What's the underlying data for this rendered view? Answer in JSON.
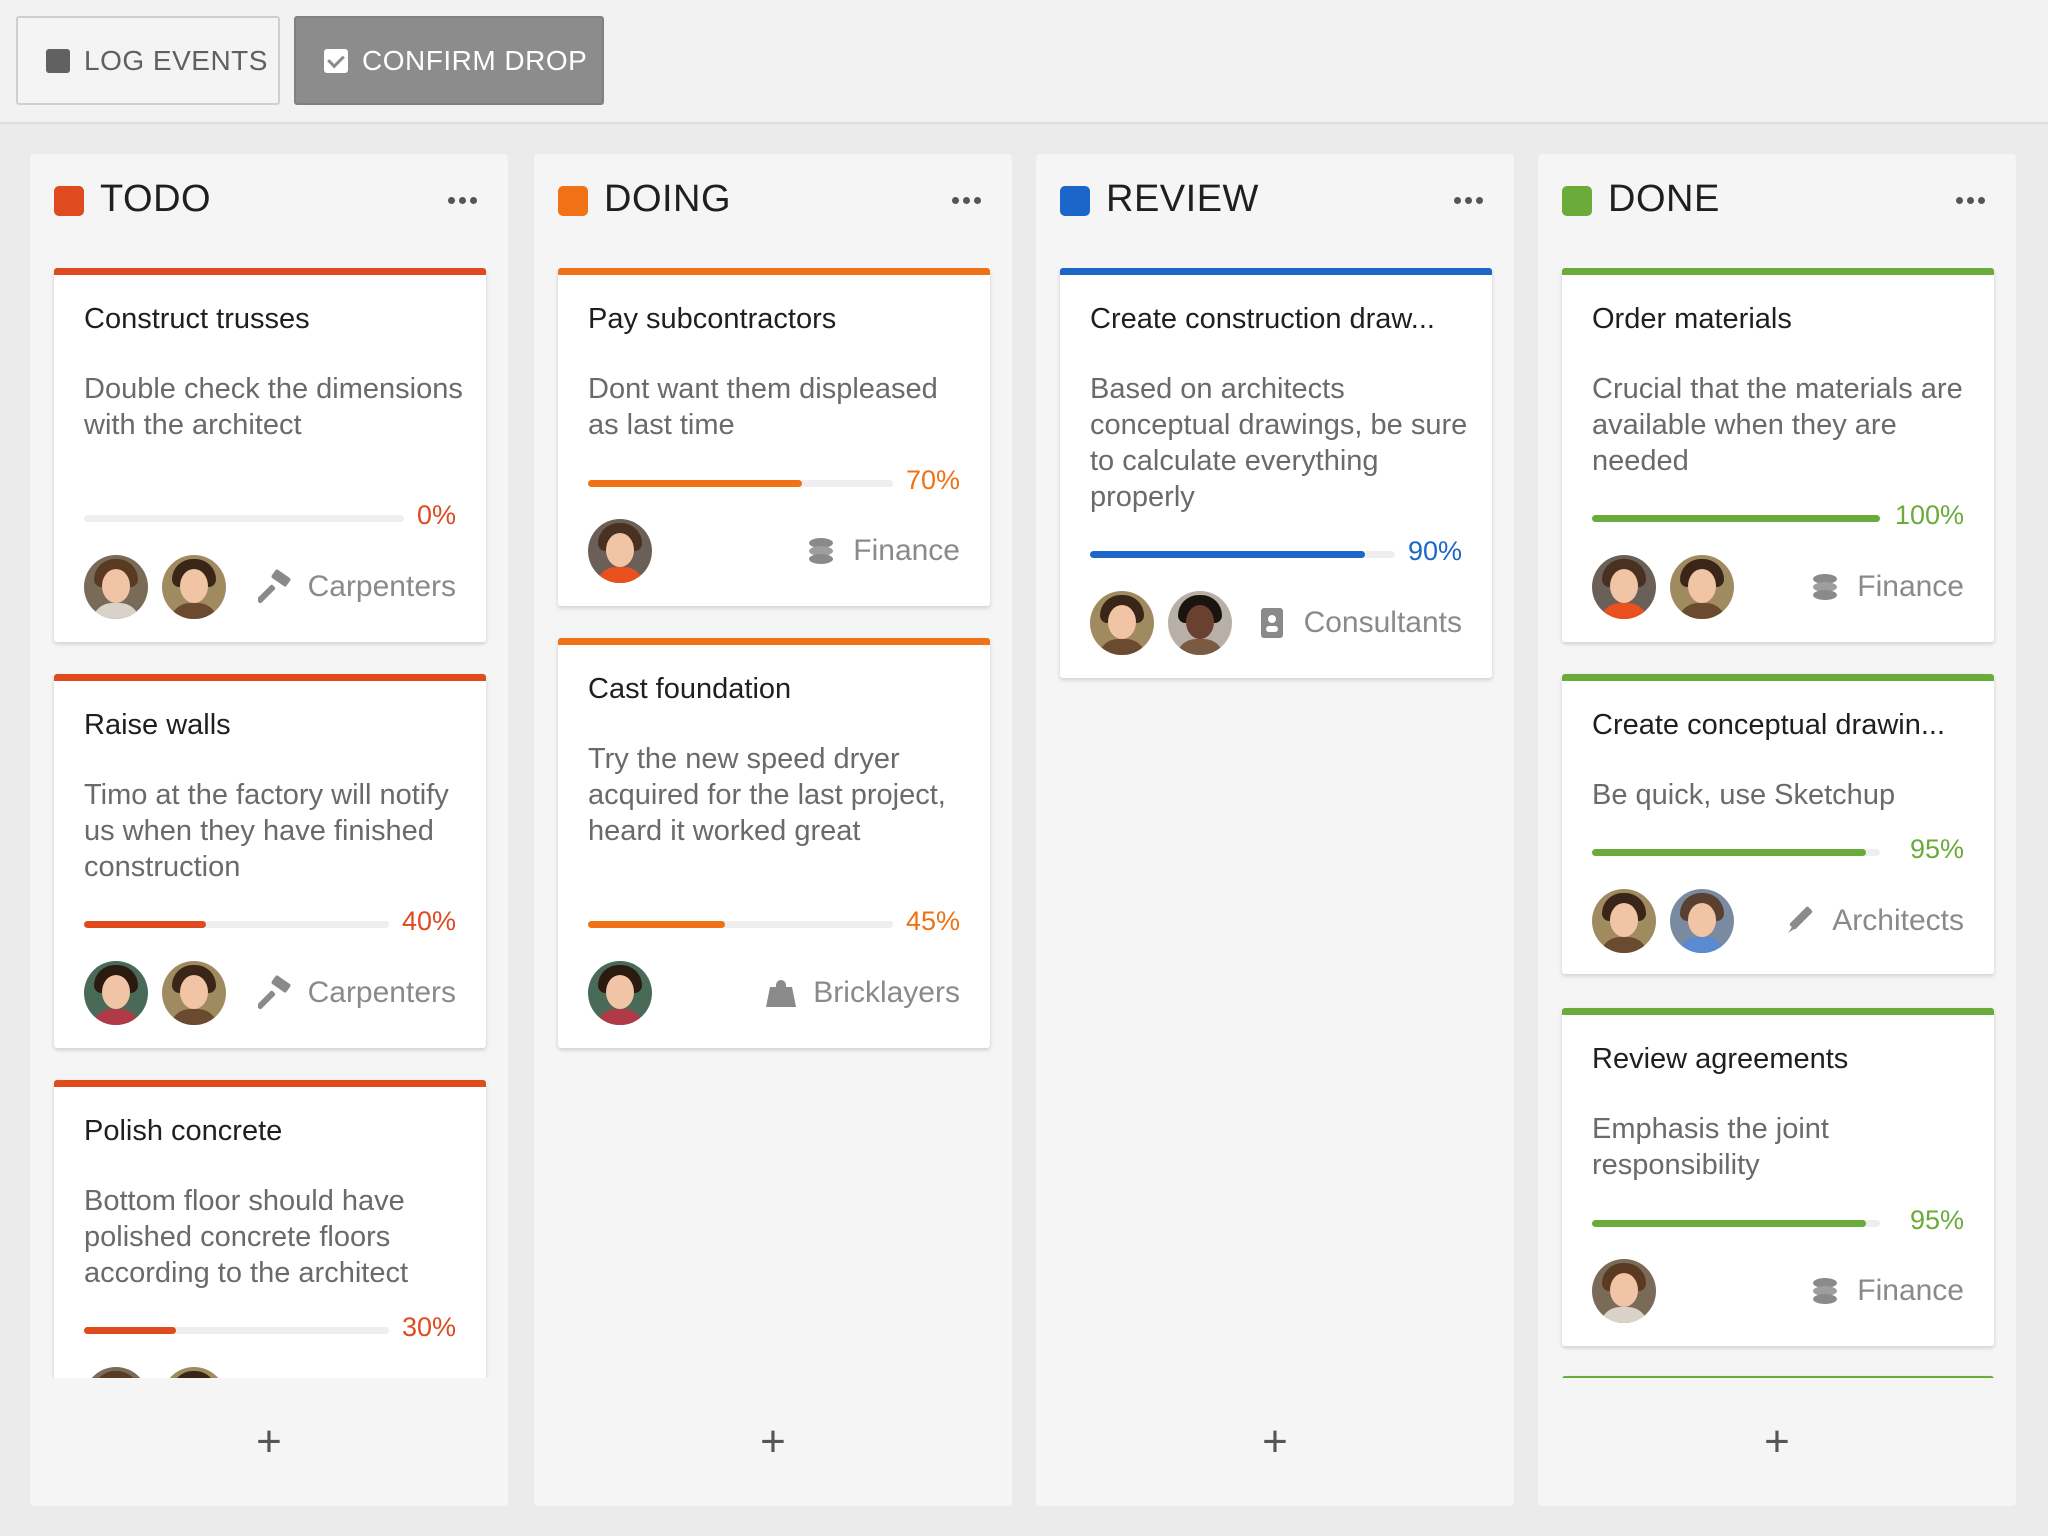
{
  "toolbar": {
    "log_events": "LOG EVENTS",
    "confirm_drop": "CONFIRM DROP"
  },
  "colors": {
    "todo": "#e04a1f",
    "doing": "#f07116",
    "review": "#1b66c9",
    "done": "#6aab3a"
  },
  "add_label": "+",
  "columns": [
    {
      "title": "TODO",
      "cards": [
        {
          "title": "Construct trusses",
          "description": "Double check the dimensions with the architect",
          "progress": 0,
          "percent": "0%",
          "team": "Carpenters",
          "team_icon": "hammer-icon"
        },
        {
          "title": "Raise walls",
          "description": "Timo at the factory will notify us when they have finished construction",
          "progress": 40,
          "percent": "40%",
          "team": "Carpenters",
          "team_icon": "hammer-icon"
        },
        {
          "title": "Polish concrete",
          "description": "Bottom floor should have polished concrete floors according to the architect",
          "progress": 30,
          "percent": "30%"
        }
      ]
    },
    {
      "title": "DOING",
      "cards": [
        {
          "title": "Pay subcontractors",
          "description": "Dont want them displeased as last time",
          "progress": 70,
          "percent": "70%",
          "team": "Finance",
          "team_icon": "coins-icon"
        },
        {
          "title": "Cast foundation",
          "description": "Try the new speed dryer acquired for the last project, heard it worked great",
          "progress": 45,
          "percent": "45%",
          "team": "Bricklayers",
          "team_icon": "weight-icon"
        }
      ]
    },
    {
      "title": "REVIEW",
      "cards": [
        {
          "title": "Create construction draw...",
          "description": "Based on architects conceptual drawings, be sure to calculate everything properly",
          "progress": 90,
          "percent": "90%",
          "team": "Consultants",
          "team_icon": "id-badge-icon"
        }
      ]
    },
    {
      "title": "DONE",
      "cards": [
        {
          "title": "Order materials",
          "description": "Crucial that the materials are available when they are needed",
          "progress": 100,
          "percent": "100%",
          "team": "Finance",
          "team_icon": "coins-icon"
        },
        {
          "title": "Create conceptual drawin...",
          "description": "Be quick, use Sketchup",
          "progress": 95,
          "percent": "95%",
          "team": "Architects",
          "team_icon": "pen-icon"
        },
        {
          "title": "Review agreements",
          "description": "Emphasis the joint responsibility",
          "progress": 95,
          "percent": "95%",
          "team": "Finance",
          "team_icon": "coins-icon"
        }
      ]
    }
  ]
}
